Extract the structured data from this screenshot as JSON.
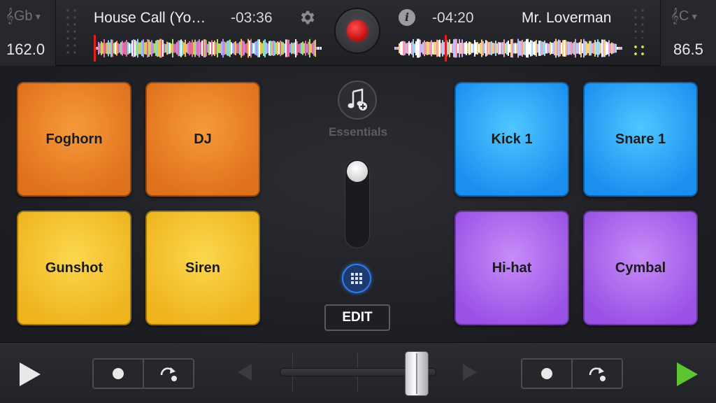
{
  "deck_left": {
    "key": "Gb",
    "bpm": "162.0",
    "track_title": "House Call (Yo…",
    "time_remaining": "-03:36",
    "waveform_position": 0.0
  },
  "deck_right": {
    "key": "C",
    "bpm": "86.5",
    "track_title": "Mr. Loverman",
    "time_remaining": "-04:20",
    "waveform_position": 0.22
  },
  "center": {
    "sample_pack_label": "Essentials",
    "edit_label": "EDIT",
    "volume_level": 1.0
  },
  "pads_left": [
    {
      "label": "Foghorn",
      "color": "orange"
    },
    {
      "label": "DJ",
      "color": "orange"
    },
    {
      "label": "Gunshot",
      "color": "yellow"
    },
    {
      "label": "Siren",
      "color": "yellow"
    }
  ],
  "pads_right": [
    {
      "label": "Kick 1",
      "color": "blue"
    },
    {
      "label": "Snare 1",
      "color": "blue"
    },
    {
      "label": "Hi-hat",
      "color": "purple"
    },
    {
      "label": "Cymbal",
      "color": "purple"
    }
  ],
  "crossfader": {
    "position": 0.94
  },
  "colors": {
    "record_red": "#d01414",
    "play_right_green": "#5cc531",
    "play_left_white": "#e8e8e8",
    "grid_button_blue": "#2f7cf0",
    "pad_orange": "#e8832a",
    "pad_yellow": "#f4c434",
    "pad_blue": "#2aa8f8",
    "pad_purple": "#ae6cee",
    "beat_indicator_green": "#c8e84a"
  },
  "icons": {
    "gear": "gear-icon",
    "info": "info-icon",
    "record": "record-icon",
    "music_add": "music-note-add-icon",
    "grid": "grid-icon",
    "play": "play-icon",
    "loop": "redo-arrow-icon"
  }
}
